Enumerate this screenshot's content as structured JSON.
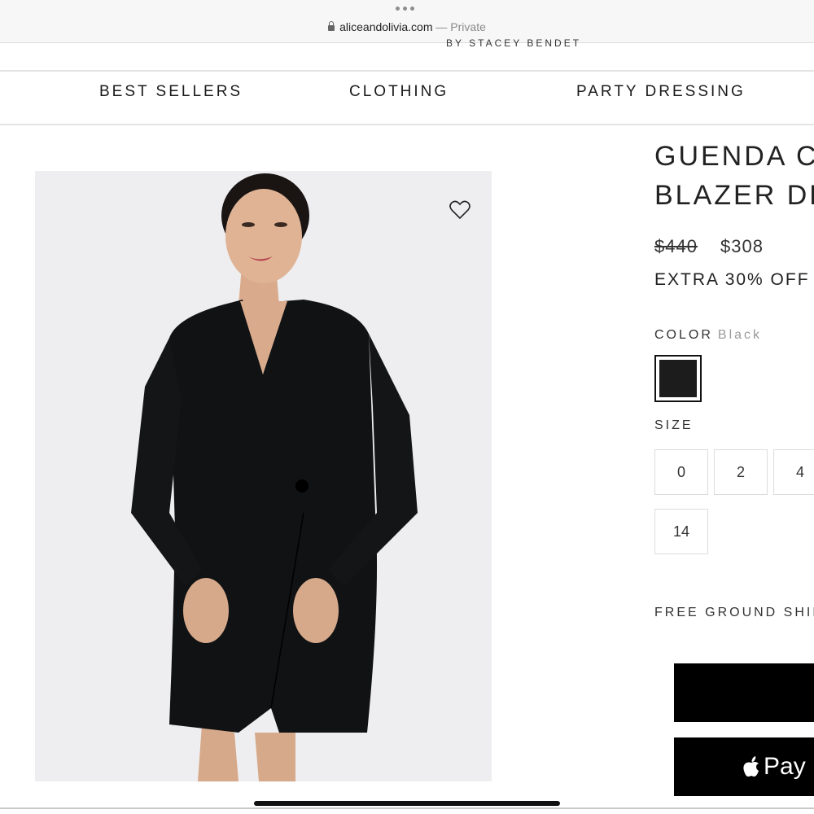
{
  "browser": {
    "url": "aliceandolivia.com",
    "mode": "Private",
    "separator": "—"
  },
  "brand": {
    "tagline": "BY STACEY BENDET"
  },
  "nav": {
    "items": [
      {
        "label": "BEST SELLERS"
      },
      {
        "label": "CLOTHING"
      },
      {
        "label": "PARTY DRESSING"
      }
    ]
  },
  "product": {
    "title": "GUENDA C\nBLAZER DRE",
    "price_original": "$440",
    "price_sale": "$308",
    "promo": "EXTRA 30% OFF",
    "color_label": "COLOR",
    "color_value": "Black",
    "size_label": "SIZE",
    "sizes": [
      "0",
      "2",
      "4",
      "14"
    ],
    "shipping": "FREE GROUND SHIP"
  },
  "actions": {
    "applepay_label": "Pay"
  },
  "colors": {
    "swatch": "#1c1c1c",
    "button": "#000000",
    "image_bg": "#eeeef0"
  },
  "icons": [
    "lock-icon",
    "heart-icon",
    "apple-icon"
  ]
}
